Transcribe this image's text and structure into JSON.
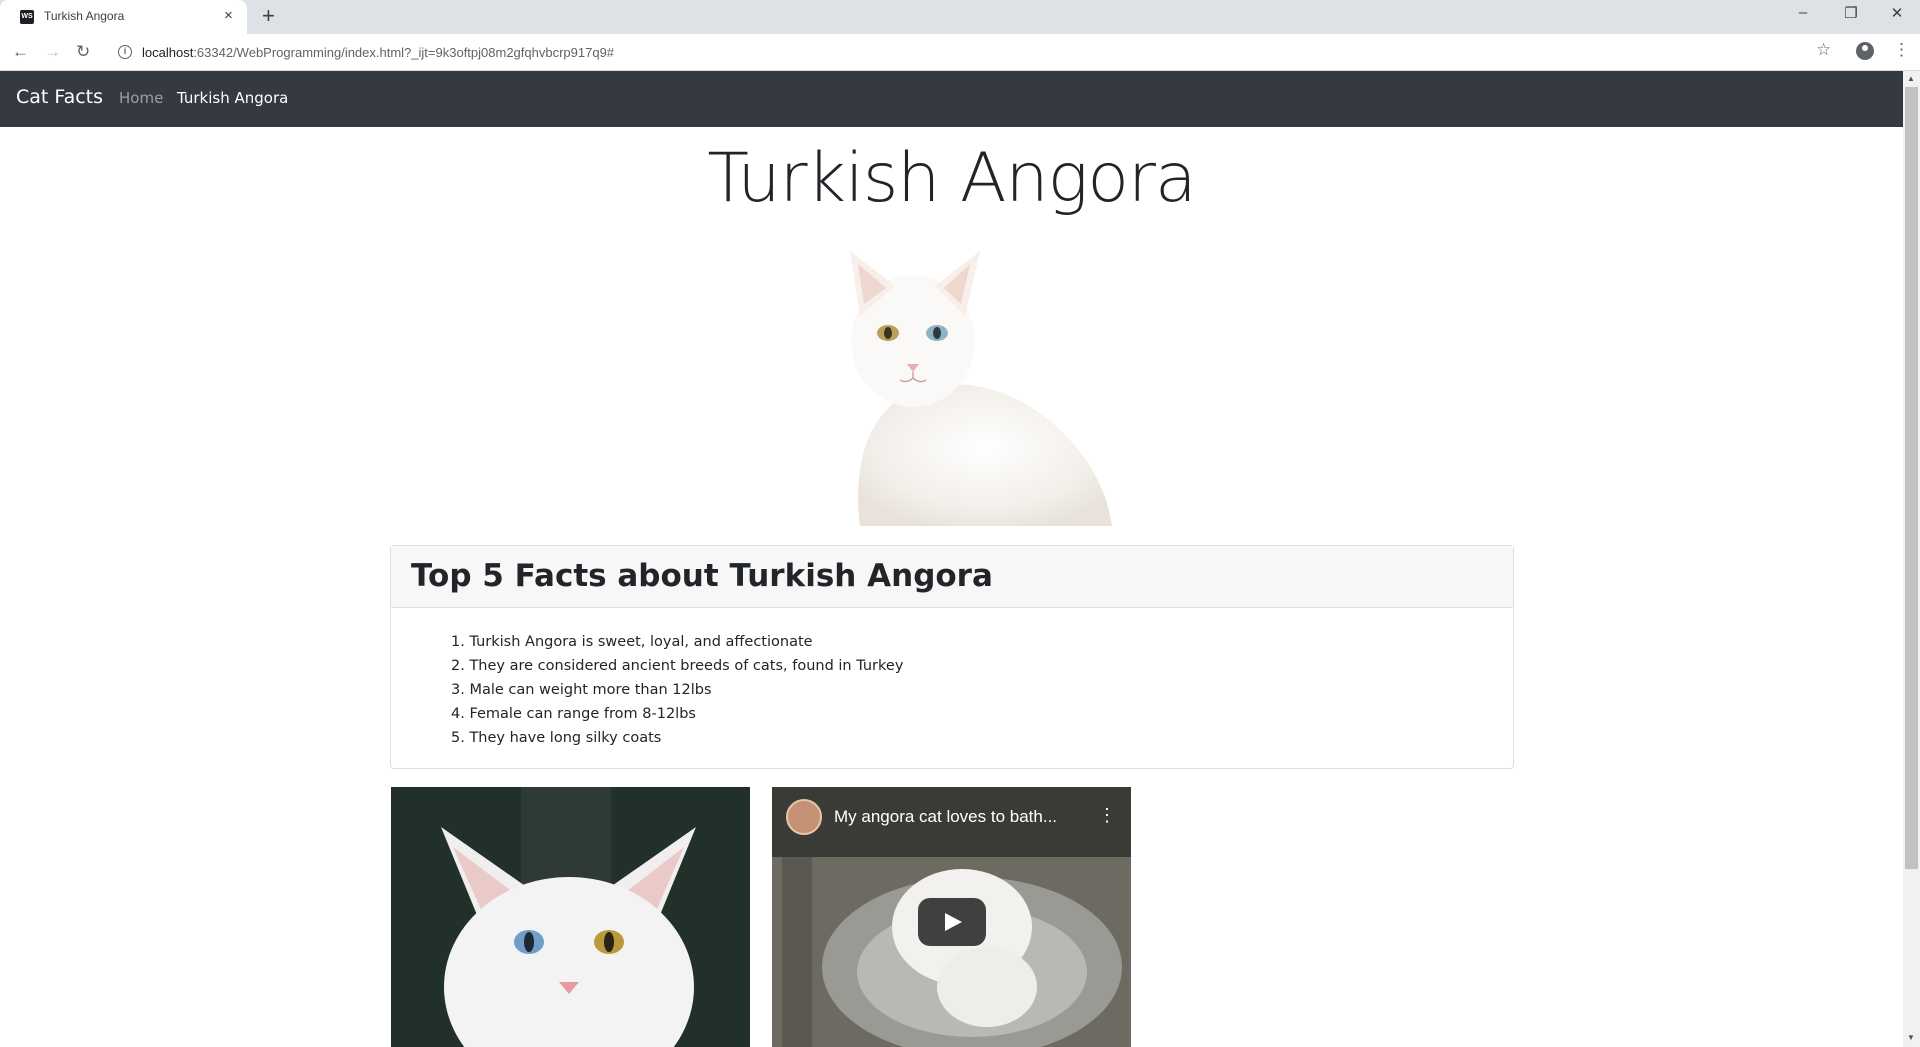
{
  "browser": {
    "tab_title": "Turkish Angora",
    "favicon_text": "WS",
    "new_tab_symbol": "+",
    "close_symbol": "×",
    "url_host": "localhost",
    "url_rest": ":63342/WebProgramming/index.html?_ijt=9k3oftpj08m2gfqhvbcrp917q9#",
    "window_controls": [
      "–",
      "❐",
      "✕"
    ]
  },
  "navbar": {
    "brand": "Cat Facts",
    "links": [
      "Home",
      "Turkish Angora"
    ]
  },
  "page": {
    "heading": "Turkish Angora"
  },
  "card": {
    "title": "Top 5 Facts about Turkish Angora",
    "facts": [
      "1. Turkish Angora is sweet, loyal, and affectionate",
      "2. They are considered ancient breeds of cats, found in Turkey",
      "3. Male can weight more than 12lbs",
      "4. Female can range from 8-12lbs",
      "5. They have long silky coats"
    ]
  },
  "video": {
    "title": "My angora cat loves to bath..."
  }
}
